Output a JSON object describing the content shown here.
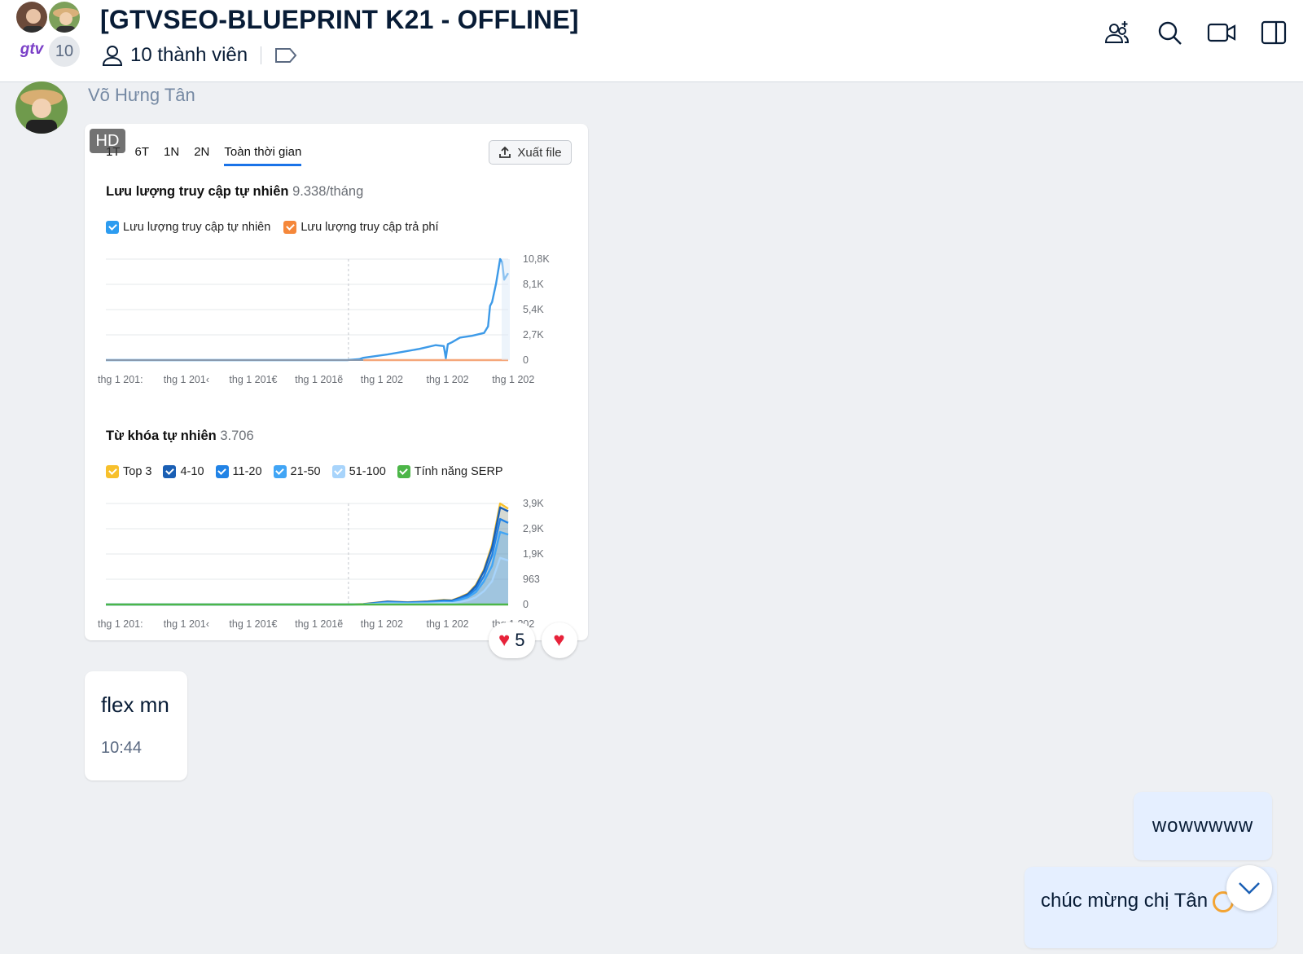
{
  "header": {
    "logo_text": "gtv",
    "member_badge": "10",
    "title": "[GTVSEO-BLUEPRINT K21 - OFFLINE]",
    "members_label": "10 thành viên",
    "icons": [
      "add-member-icon",
      "search-icon",
      "video-call-icon",
      "sidebar-toggle-icon"
    ]
  },
  "message_image": {
    "sender": "Võ Hưng Tân",
    "hd_badge": "HD",
    "tabs": [
      "1T",
      "6T",
      "1N",
      "2N",
      "Toàn thời gian"
    ],
    "active_tab": "Toàn thời gian",
    "export_label": "Xuất file",
    "traffic": {
      "title": "Lưu lượng truy cập tự nhiên",
      "value": "9.338/tháng",
      "legend": [
        {
          "label": "Lưu lượng truy cập tự nhiên",
          "color": "#2d9cf0"
        },
        {
          "label": "Lưu lượng truy cập trả phí",
          "color": "#f5873a"
        }
      ]
    },
    "keywords": {
      "title": "Từ khóa tự nhiên",
      "value": "3.706",
      "legend": [
        {
          "label": "Top 3",
          "color": "#f7c02c"
        },
        {
          "label": "4-10",
          "color": "#1a5fb4"
        },
        {
          "label": "11-20",
          "color": "#2183e6"
        },
        {
          "label": "21-50",
          "color": "#41a5f5"
        },
        {
          "label": "51-100",
          "color": "#a8d4fb"
        },
        {
          "label": "Tính năng SERP",
          "color": "#4cb648"
        }
      ]
    },
    "reactions": {
      "count": "5"
    }
  },
  "chart_data": [
    {
      "type": "line",
      "title": "Lưu lượng truy cập tự nhiên",
      "x_ticks": [
        "thg 1 201:",
        "thg 1 201‹",
        "thg 1 201€",
        "thg 1 201ẽ",
        "thg 1 202",
        "thg 1 202",
        "thg 1 202"
      ],
      "y_ticks": [
        "10,8K",
        "8,1K",
        "5,4K",
        "2,7K",
        "0"
      ],
      "ylim": [
        0,
        10800
      ],
      "grid": true,
      "series": [
        {
          "name": "Lưu lượng truy cập tự nhiên",
          "color": "#3d9ae8",
          "x": [
            0,
            0.1,
            0.2,
            0.3,
            0.4,
            0.5,
            0.6,
            0.63,
            0.64,
            0.7,
            0.74,
            0.78,
            0.82,
            0.84,
            0.845,
            0.85,
            0.86,
            0.88,
            0.91,
            0.94,
            0.95,
            0.955,
            0.96,
            0.97,
            0.98,
            0.985,
            0.99,
            1.0
          ],
          "y": [
            0,
            0,
            0,
            0,
            0,
            0,
            0,
            100,
            250,
            600,
            900,
            1200,
            1600,
            1500,
            200,
            1700,
            1900,
            2400,
            2600,
            2900,
            3600,
            5800,
            6200,
            8200,
            10800,
            10500,
            8600,
            9300
          ]
        },
        {
          "name": "Lưu lượng truy cập trả phí",
          "color": "#f5a77a",
          "x": [
            0.64,
            1.0
          ],
          "y": [
            0,
            0
          ]
        }
      ]
    },
    {
      "type": "area",
      "title": "Từ khóa tự nhiên",
      "x_ticks": [
        "thg 1 201:",
        "thg 1 201‹",
        "thg 1 201€",
        "thg 1 201ẽ",
        "thg 1 202",
        "thg 1 202",
        "thg 1 202"
      ],
      "y_ticks": [
        "3,9K",
        "2,9K",
        "1,9K",
        "963",
        "0"
      ],
      "ylim": [
        0,
        3900
      ],
      "grid": true,
      "x": [
        0,
        0.4,
        0.6,
        0.64,
        0.7,
        0.75,
        0.8,
        0.84,
        0.86,
        0.88,
        0.9,
        0.92,
        0.94,
        0.96,
        0.98,
        1.0
      ],
      "series": [
        {
          "name": "Top 3",
          "color": "#f7c02c",
          "values": [
            0,
            0,
            0,
            20,
            120,
            90,
            120,
            180,
            160,
            280,
            420,
            760,
            1350,
            2300,
            3900,
            3700
          ]
        },
        {
          "name": "4-10",
          "color": "#1a5fb4",
          "values": [
            0,
            0,
            0,
            15,
            110,
            80,
            110,
            160,
            150,
            260,
            400,
            720,
            1300,
            2200,
            3750,
            3600
          ]
        },
        {
          "name": "11-20",
          "color": "#2183e6",
          "values": [
            0,
            0,
            0,
            10,
            90,
            70,
            90,
            130,
            120,
            220,
            340,
            600,
            1100,
            1900,
            3300,
            3150
          ]
        },
        {
          "name": "21-50",
          "color": "#41a5f5",
          "values": [
            0,
            0,
            0,
            8,
            70,
            55,
            70,
            100,
            95,
            180,
            280,
            480,
            900,
            1500,
            2800,
            2700
          ]
        },
        {
          "name": "51-100",
          "color": "#a8d4fb",
          "values": [
            0,
            0,
            0,
            5,
            40,
            30,
            40,
            60,
            55,
            100,
            160,
            280,
            520,
            900,
            1800,
            1700
          ]
        },
        {
          "name": "Tính năng SERP",
          "color": "#4cb648",
          "values": [
            0,
            0,
            0,
            0,
            0,
            0,
            0,
            0,
            0,
            0,
            0,
            0,
            0,
            0,
            0,
            0
          ]
        }
      ]
    }
  ],
  "message_text": {
    "body": "flex mn",
    "time": "10:44"
  },
  "my_messages": [
    "wowwwww",
    "chúc mừng chị Tân"
  ]
}
